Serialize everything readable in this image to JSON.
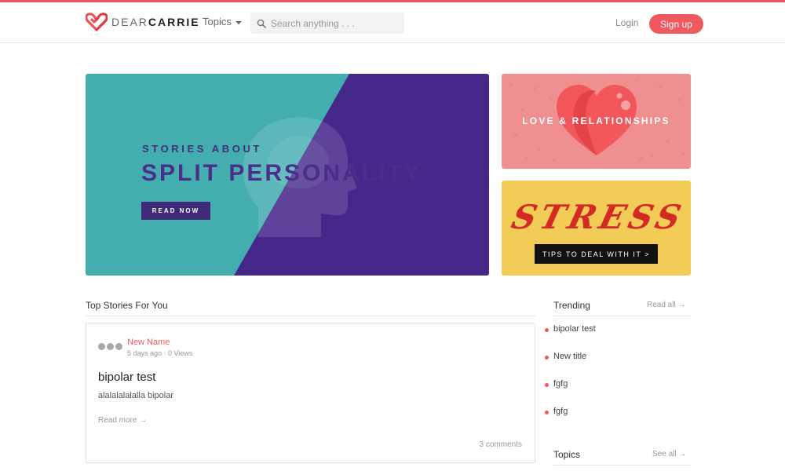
{
  "header": {
    "logo_dear": "DEAR",
    "logo_carrie": "CARRIE",
    "topics_label": "Topics",
    "search_placeholder": "Search anything . . .",
    "login_label": "Login",
    "signup_label": "Sign up"
  },
  "hero": {
    "kicker": "STORIES ABOUT",
    "title": "SPLIT PERSONALITY",
    "button_label": "READ NOW"
  },
  "side_cards": {
    "love": {
      "label": "LOVE & RELATIONSHIPS"
    },
    "stress": {
      "word": "STRESS",
      "button_label": "TIPS TO DEAL WITH IT >"
    }
  },
  "top_stories": {
    "section_title": "Top Stories For You",
    "story": {
      "author": "New Name",
      "meta": "5 days ago · 0 Views",
      "title": "bipolar test",
      "excerpt": "alalalalalalla bipolar",
      "read_more": "Read more →",
      "comments": "3 comments"
    }
  },
  "trending": {
    "title": "Trending",
    "read_all": "Read all →",
    "items": [
      "bipolar test",
      "New title",
      "fgfg",
      "fgfg"
    ]
  },
  "topics": {
    "title": "Topics",
    "see_all": "See all →"
  },
  "colors": {
    "accent": "#f05a5f",
    "hero_teal": "#43adb0",
    "hero_purple": "#46288a",
    "love_bg": "#ef8f8f",
    "stress_bg": "#f2cc57"
  },
  "icons": [
    "heart-logo-icon",
    "search-icon",
    "caret-down-icon",
    "head-silhouette-icon",
    "heart-icon"
  ]
}
